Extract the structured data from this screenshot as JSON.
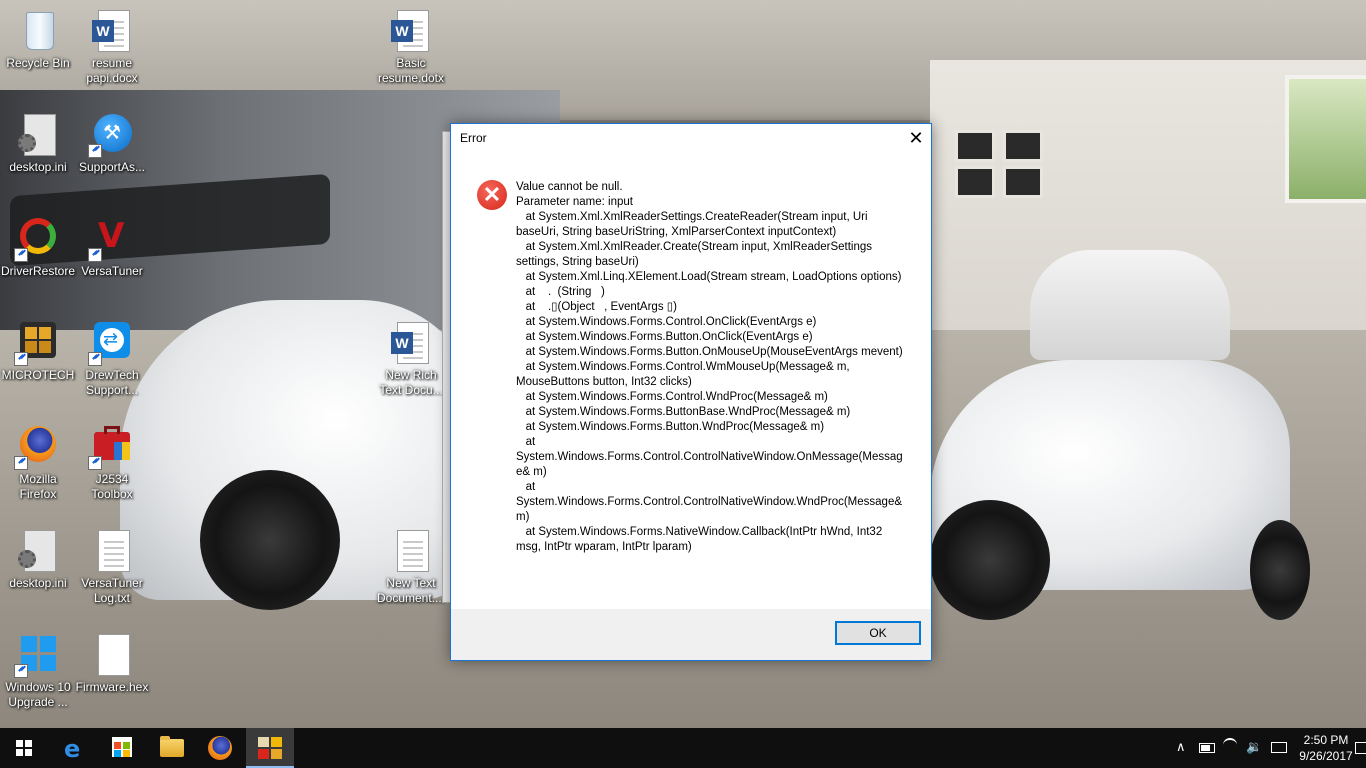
{
  "desktop": {
    "icons": [
      {
        "label": "Recycle Bin"
      },
      {
        "label": "resume\npapi.docx"
      },
      {
        "label": "Basic\nresume.dotx"
      },
      {
        "label": "desktop.ini"
      },
      {
        "label": "SupportAs..."
      },
      {
        "label": "DriverRestore"
      },
      {
        "label": "VersaTuner"
      },
      {
        "label": "MICROTECH"
      },
      {
        "label": "DrewTech\nSupport..."
      },
      {
        "label": "New Rich\nText Docu..."
      },
      {
        "label": "Mozilla\nFirefox"
      },
      {
        "label": "J2534\nToolbox"
      },
      {
        "label": "desktop.ini"
      },
      {
        "label": "VersaTuner\nLog.txt"
      },
      {
        "label": "New Text\nDocument...."
      },
      {
        "label": "Windows 10\nUpgrade ..."
      },
      {
        "label": "Firmware.hex"
      }
    ]
  },
  "dialog": {
    "title": "Error",
    "message_lines": [
      "Value cannot be null.",
      "Parameter name: input",
      "   at System.Xml.XmlReaderSettings.CreateReader(Stream input, Uri baseUri, String baseUriString, XmlParserContext inputContext)",
      "   at System.Xml.XmlReader.Create(Stream input, XmlReaderSettings settings, String baseUri)",
      "   at System.Xml.Linq.XElement.Load(Stream stream, LoadOptions options)",
      "   at    .  (String   )",
      "   at    .▯(Object   , EventArgs ▯)",
      "   at System.Windows.Forms.Control.OnClick(EventArgs e)",
      "   at System.Windows.Forms.Button.OnClick(EventArgs e)",
      "   at System.Windows.Forms.Button.OnMouseUp(MouseEventArgs mevent)",
      "   at System.Windows.Forms.Control.WmMouseUp(Message& m, MouseButtons button, Int32 clicks)",
      "   at System.Windows.Forms.Control.WndProc(Message& m)",
      "   at System.Windows.Forms.ButtonBase.WndProc(Message& m)",
      "   at System.Windows.Forms.Button.WndProc(Message& m)",
      "   at",
      "System.Windows.Forms.Control.ControlNativeWindow.OnMessage(Message& m)",
      "   at",
      "System.Windows.Forms.Control.ControlNativeWindow.WndProc(Message& m)",
      "   at System.Windows.Forms.NativeWindow.Callback(IntPtr hWnd, Int32 msg, IntPtr wparam, IntPtr lparam)"
    ],
    "ok_label": "OK",
    "close_glyph": "✕",
    "error_glyph": "✕"
  },
  "taskbar": {
    "apps": [
      "start",
      "edge",
      "store",
      "file-explorer",
      "firefox",
      "microtech"
    ],
    "active_app": "microtech",
    "tray": {
      "chevron": "∧",
      "volume": "🔉",
      "notification": "☐"
    },
    "clock": {
      "time": "2:50 PM",
      "date": "9/26/2017"
    }
  },
  "colors": {
    "dialog_border": "#1a74d6",
    "error_red": "#d8261a",
    "taskbar_bg": "#0f0f10",
    "button_focus": "#0078d7"
  }
}
